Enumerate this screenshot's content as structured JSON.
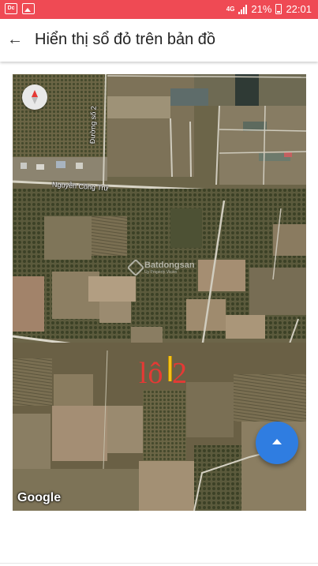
{
  "status_bar": {
    "left_icons": [
      "notification-icon",
      "image-icon"
    ],
    "network": "4G",
    "battery_percent": "21%",
    "time": "22:01",
    "background_color": "#ef4a54"
  },
  "app_bar": {
    "title": "Hiển thị sổ đỏ trên bản đồ",
    "back_icon": "arrow-back-icon"
  },
  "map": {
    "road_labels": [
      "Nguyễn Công Trứ",
      "Đường số 2"
    ],
    "watermark_brand": "Batdongsan",
    "watermark_sub": "Uy Property Vision",
    "lot_label": "lô 2",
    "attribution": "Google",
    "compass_icon": "compass-icon"
  },
  "fab": {
    "icon": "chevron-up-icon",
    "color": "#2f7de1"
  }
}
